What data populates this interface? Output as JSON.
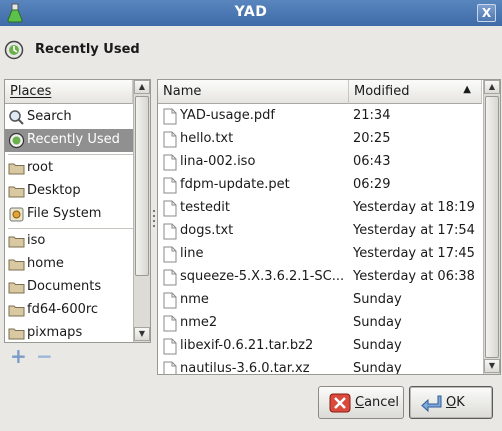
{
  "window": {
    "title": "YAD",
    "close_label": "X"
  },
  "header": {
    "title": "Recently Used"
  },
  "places": {
    "column_header": "Places",
    "items": [
      {
        "label": "Search",
        "icon": "search-icon"
      },
      {
        "label": "Recently Used",
        "icon": "recent-icon",
        "selected": true
      },
      {
        "label": "root",
        "icon": "folder-icon"
      },
      {
        "label": "Desktop",
        "icon": "folder-icon"
      },
      {
        "label": "File System",
        "icon": "drive-icon"
      },
      {
        "label": "iso",
        "icon": "folder-icon"
      },
      {
        "label": "home",
        "icon": "folder-icon"
      },
      {
        "label": "Documents",
        "icon": "folder-icon"
      },
      {
        "label": "fd64-600rc",
        "icon": "folder-icon"
      },
      {
        "label": "pixmaps",
        "icon": "folder-icon"
      }
    ],
    "add_label": "+",
    "remove_label": "−"
  },
  "files": {
    "columns": {
      "name": "Name",
      "modified": "Modified",
      "sort_indicator": "▲"
    },
    "rows": [
      {
        "name": "YAD-usage.pdf",
        "modified": "21:34"
      },
      {
        "name": "hello.txt",
        "modified": "20:25"
      },
      {
        "name": "lina-002.iso",
        "modified": "06:43"
      },
      {
        "name": "fdpm-update.pet",
        "modified": "06:29"
      },
      {
        "name": "testedit",
        "modified": "Yesterday at 18:19"
      },
      {
        "name": "dogs.txt",
        "modified": "Yesterday at 17:54"
      },
      {
        "name": "line",
        "modified": "Yesterday at 17:45"
      },
      {
        "name": "squeeze-5.X.3.6.2.1-SC...",
        "modified": "Yesterday at 06:38"
      },
      {
        "name": "nme",
        "modified": "Sunday"
      },
      {
        "name": "nme2",
        "modified": "Sunday"
      },
      {
        "name": "libexif-0.6.21.tar.bz2",
        "modified": "Sunday"
      },
      {
        "name": "nautilus-3.6.0.tar.xz",
        "modified": "Sunday"
      }
    ]
  },
  "buttons": {
    "cancel_label": "Cancel",
    "ok_label": "OK"
  },
  "colors": {
    "titlebar": "#4a76b2",
    "selection": "#909090",
    "dialog_bg": "#e9e8e4"
  }
}
